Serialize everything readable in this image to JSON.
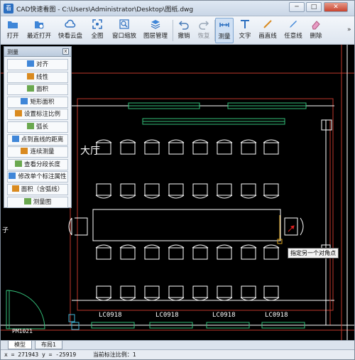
{
  "window": {
    "app_title": "CAD快速看图 - C:\\Users\\Administrator\\Desktop\\图纸.dwg",
    "minimize": "─",
    "maximize": "□",
    "close": "✕"
  },
  "toolbar": {
    "items": [
      {
        "label": "打开",
        "icon": "folder-open-icon"
      },
      {
        "label": "最近打开",
        "icon": "recent-files-icon"
      },
      {
        "label": "快看云盘",
        "icon": "cloud-icon"
      },
      {
        "label": "全图",
        "icon": "full-view-icon"
      },
      {
        "label": "窗口缩放",
        "icon": "zoom-window-icon"
      },
      {
        "label": "图层管理",
        "icon": "layers-icon"
      },
      {
        "label": "撤销",
        "icon": "undo-icon"
      },
      {
        "label": "恢复",
        "icon": "redo-icon"
      },
      {
        "label": "测量",
        "icon": "measure-icon"
      },
      {
        "label": "文字",
        "icon": "text-icon"
      },
      {
        "label": "画直线",
        "icon": "draw-line-icon"
      },
      {
        "label": "任意线",
        "icon": "freehand-line-icon"
      },
      {
        "label": "删除",
        "icon": "eraser-icon"
      }
    ]
  },
  "measure_panel": {
    "title": "测量",
    "close": "x",
    "items": [
      {
        "label": "对齐",
        "icon": "align-measure-icon"
      },
      {
        "label": "线性",
        "icon": "linear-measure-icon"
      },
      {
        "label": "面积",
        "icon": "area-icon"
      },
      {
        "label": "矩形面积",
        "icon": "rect-area-icon"
      },
      {
        "label": "设置标注比例",
        "icon": "scale-icon"
      },
      {
        "label": "弧长",
        "icon": "arc-length-icon"
      },
      {
        "label": "点到直线的距离",
        "icon": "point-line-distance-icon"
      },
      {
        "label": "连续测量",
        "icon": "continuous-measure-icon"
      },
      {
        "label": "查看分段长度",
        "icon": "segment-length-icon"
      },
      {
        "label": "修改单个标注属性",
        "icon": "edit-dimension-icon"
      },
      {
        "label": "面积（含弧线）",
        "icon": "arc-area-icon"
      },
      {
        "label": "测量图",
        "icon": "measure-map-icon"
      }
    ]
  },
  "drawing": {
    "room_label": "大厅",
    "window_labels": [
      "LC0918",
      "LC0918",
      "LC0918",
      "LC0918"
    ],
    "door_label": "PM1021",
    "left_mark": "子"
  },
  "tooltip": "指定另一个对角点",
  "tabs": [
    "模型",
    "布局1"
  ],
  "status": {
    "coords": "x = 271943  y = -25919",
    "scale": "当前标注比例：1"
  },
  "colors": {
    "canvas": "#000000",
    "line_white": "#ffffff",
    "line_green": "#34c07a",
    "line_red": "#c0392b",
    "line_cyan": "#3fb6d8",
    "accent_blue": "#2c6fc0"
  }
}
